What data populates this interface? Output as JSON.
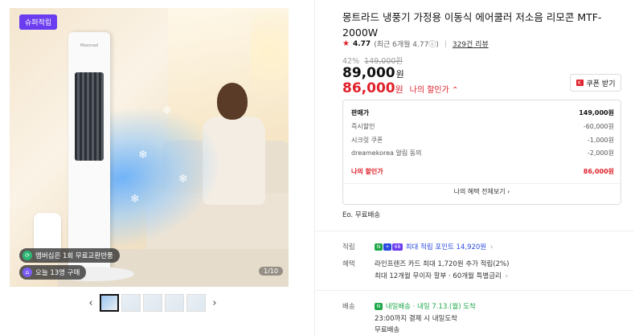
{
  "gallery": {
    "badge": "슈퍼적립",
    "product_brand_on_device": "Moonrad",
    "pill_membership": "멤버십은 1회 무료교환반품",
    "pill_today": "오늘 13명 구매",
    "counter": "1/10",
    "thumb_count": 5,
    "active_thumb_index": 0
  },
  "product": {
    "title": "몽트라드 냉풍기 가정용 이동식 에어쿨러 저소음 리모콘 MTF-2000W",
    "rating_score": "4.77",
    "rating_recent": "(최근 6개월 4.77",
    "rating_info_icon": "ⓘ",
    "rating_recent_close": ")",
    "review_link": "329건 리뷰",
    "discount_pct": "42%",
    "original_price": "149,000원",
    "price": "89,000",
    "price_unit": "원",
    "my_price": "86,000",
    "my_price_unit": "원",
    "my_price_label": "나의 할인가",
    "my_price_chevron": "⌃",
    "coupon_button": "쿠폰 받기",
    "coupon_icon_text": "K"
  },
  "breakdown": {
    "rows": [
      {
        "label": "판매가",
        "value": "149,000원"
      },
      {
        "label": "즉시할인",
        "value": "-60,000원"
      },
      {
        "label": "시크릿 쿠폰",
        "value": "-1,000원"
      },
      {
        "label": "dreamekorea 알림 동의",
        "value": "-2,000원"
      }
    ],
    "my_label": "나의 할인가",
    "my_value": "86,000원",
    "footer": "나의 혜택 전체보기",
    "footer_chevron": "›"
  },
  "shipping_note": "무료배송",
  "shipping_note_prefix": "Eo.",
  "points": {
    "label": "적립",
    "badge_n": "N",
    "badge_plus": "+",
    "badge_extra": "68",
    "text": "최대 적립 포인트 14,920원",
    "chevron": "›"
  },
  "benefits": {
    "label": "혜택",
    "line1": "라인프렌즈 카드 최대 1,720원 추가 적립(2%)",
    "line2": "최대 12개월 무이자 할부 · 60개월 특별금리",
    "chevron": "›"
  },
  "delivery": {
    "label": "배송",
    "badge": "N",
    "line1": "내일배송 · 내일 7.13.(월) 도착",
    "line2": "23:00까지 결제 시 내일도착",
    "line3": "무료배송"
  },
  "colors": {
    "accent_red": "#e0202a",
    "badge_purple": "#6b3cf0",
    "naver_green": "#1fa84a",
    "point_blue": "#2a4be0"
  }
}
